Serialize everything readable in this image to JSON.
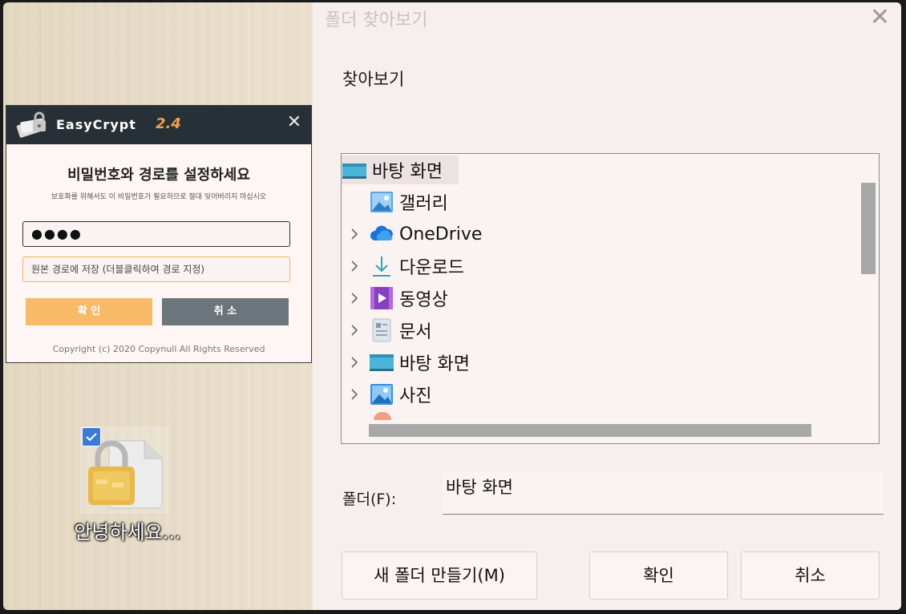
{
  "easycrypt": {
    "brand": "EasyCrypt",
    "version": "2.4",
    "close_glyph": "✕",
    "heading": "비밀번호와 경로를 설정하세요",
    "subtext": "보호화를 위해서도 이 비밀번호가 필요하므로 절대 잊어버리지 마십시오",
    "password_value": "●●●●",
    "path_placeholder": "원본 경로에 저장 (더블클릭하여 경로 지정)",
    "ok_label": "확 인",
    "cancel_label": "취 소",
    "copyright": "Copyright (c) 2020 Copynull All Rights Reserved",
    "colors": {
      "titlebar": "#263036",
      "accent": "#f8ba66",
      "cancel": "#6c747c",
      "version": "#f4a04a"
    }
  },
  "desktop": {
    "file_label": "안녕하세요...",
    "icon": "locked-file-icon",
    "checkbox": "checked"
  },
  "folder_dialog": {
    "title": "폴더 찾아보기",
    "close_glyph": "✕",
    "browse_label": "찾아보기",
    "tree": [
      {
        "label": "바탕 화면",
        "icon": "desktop-folder-icon",
        "expandable": false,
        "selected": true
      },
      {
        "label": "갤러리",
        "icon": "gallery-icon",
        "expandable": false
      },
      {
        "label": "OneDrive",
        "icon": "onedrive-cloud-icon",
        "expandable": true
      },
      {
        "label": "다운로드",
        "icon": "download-icon",
        "expandable": true
      },
      {
        "label": "동영상",
        "icon": "video-icon",
        "expandable": true
      },
      {
        "label": "문서",
        "icon": "document-icon",
        "expandable": true
      },
      {
        "label": "바탕 화면",
        "icon": "desktop-folder-icon",
        "expandable": true
      },
      {
        "label": "사진",
        "icon": "pictures-icon",
        "expandable": true
      }
    ],
    "folder_label": "폴더(F):",
    "folder_value": "바탕 화면",
    "new_folder_label": "새 폴더 만들기(M)",
    "ok_label": "확인",
    "cancel_label": "취소"
  }
}
